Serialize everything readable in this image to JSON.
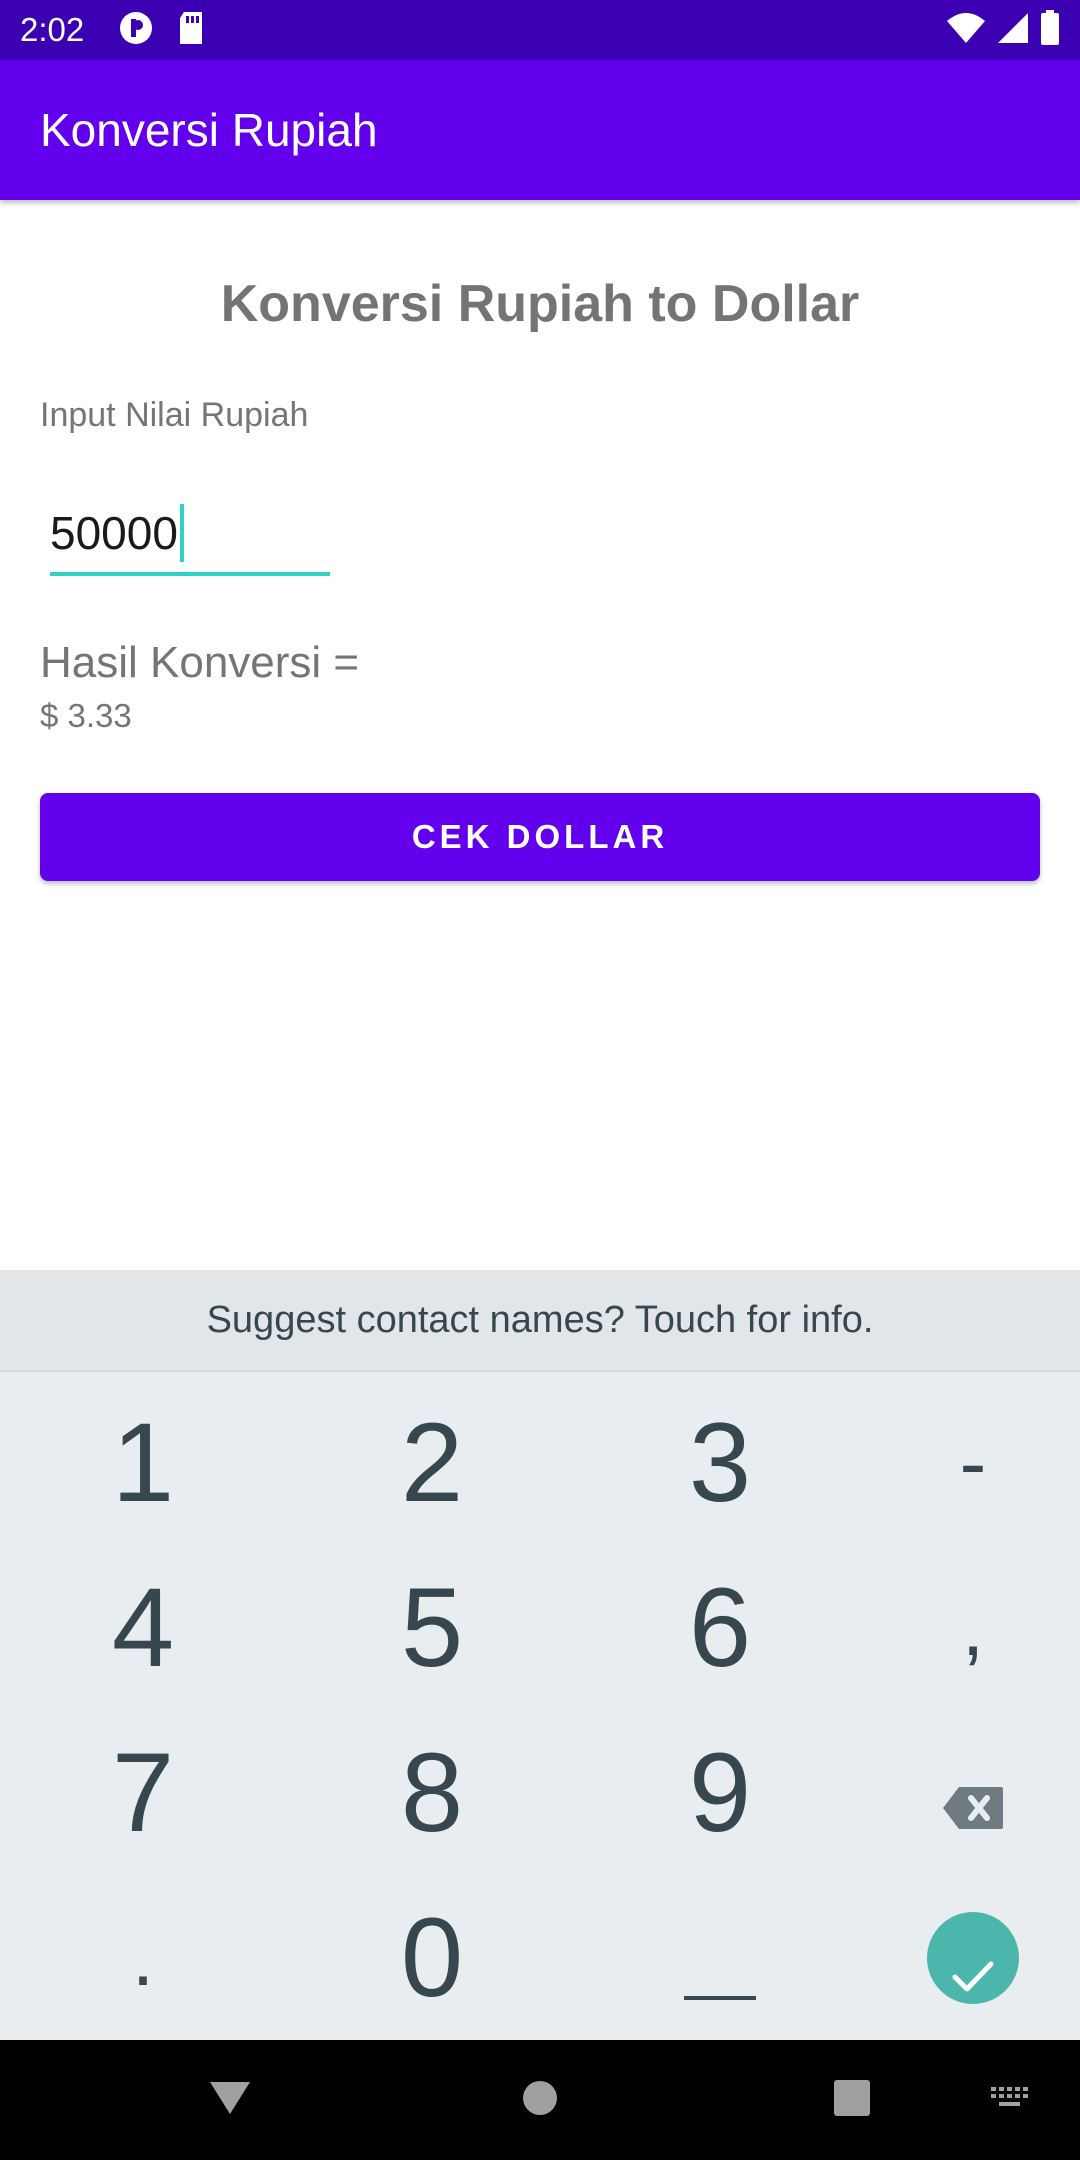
{
  "status_bar": {
    "time": "2:02",
    "left_icons": [
      "notification-p-icon",
      "sd-card-icon"
    ],
    "right_icons": [
      "wifi-icon",
      "cell-signal-icon",
      "battery-icon"
    ]
  },
  "app_bar": {
    "title": "Konversi Rupiah"
  },
  "main": {
    "heading": "Konversi Rupiah to Dollar",
    "input_label": "Input Nilai Rupiah",
    "input_value": "50000",
    "result_label": "Hasil Konversi =",
    "result_value": "$ 3.33",
    "button_label": "CEK DOLLAR"
  },
  "keyboard": {
    "suggestion": "Suggest contact names? Touch for info.",
    "row1": [
      "1",
      "2",
      "3",
      "-"
    ],
    "row2": [
      "4",
      "5",
      "6",
      ","
    ],
    "row3": [
      "7",
      "8",
      "9"
    ],
    "row4": [
      ".",
      "0",
      "␣"
    ],
    "backspace_icon": "backspace-icon",
    "done_icon": "checkmark-icon"
  },
  "nav_bar": {
    "icons": [
      "back-icon",
      "home-icon",
      "recents-icon",
      "keyboard-switch-icon"
    ]
  },
  "colors": {
    "status_bar": "#3c00b3",
    "primary": "#6200ee",
    "accent": "#2ed3c5",
    "done_key": "#4db6ac"
  }
}
